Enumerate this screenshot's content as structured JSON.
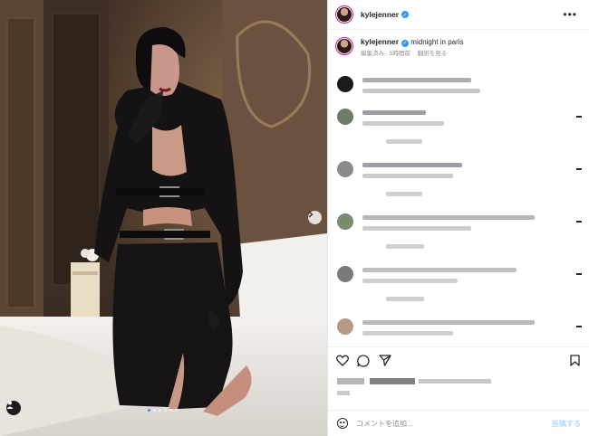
{
  "post": {
    "username": "kylejenner",
    "caption": "midnight in paris",
    "meta_edited": "編集済み · 5時間前",
    "meta_translate": "翻訳を見る"
  },
  "composer": {
    "placeholder": "コメントを追加...",
    "post_label": "投稿する"
  },
  "icons": {
    "verified": "verified-badge-icon",
    "more": "more-options-icon",
    "like": "heart-icon",
    "comment": "comment-icon",
    "share": "paper-plane-icon",
    "save": "bookmark-icon",
    "emoji": "emoji-icon",
    "next": "chevron-right-icon",
    "tag": "user-tag-icon"
  },
  "carousel": {
    "total": 6,
    "active": 1
  },
  "colors": {
    "verified": "#3897f0",
    "post_button": "#b3dbff",
    "active_dot": "#3b8bf5"
  }
}
